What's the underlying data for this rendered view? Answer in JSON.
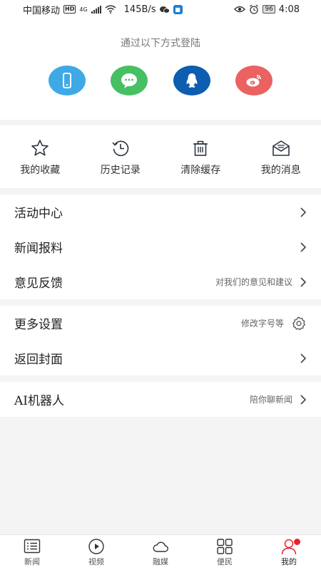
{
  "status_bar": {
    "carrier": "中国移动",
    "hd": "HD",
    "network": "4G",
    "speed": "145B/s",
    "battery": "96",
    "time": "4:08"
  },
  "login": {
    "title": "通过以下方式登陆",
    "methods": [
      {
        "icon": "phone-icon",
        "color": "#3fa9e6"
      },
      {
        "icon": "wechat-icon",
        "color": "#47bf63"
      },
      {
        "icon": "qq-icon",
        "color": "#0d5db0"
      },
      {
        "icon": "weibo-icon",
        "color": "#ea6261"
      }
    ]
  },
  "quick_actions": [
    {
      "icon": "star-icon",
      "label": "我的收藏"
    },
    {
      "icon": "history-icon",
      "label": "历史记录"
    },
    {
      "icon": "trash-icon",
      "label": "清除缓存"
    },
    {
      "icon": "mail-icon",
      "label": "我的消息"
    }
  ],
  "menu": {
    "group1": [
      {
        "label": "活动中心",
        "hint": ""
      },
      {
        "label": "新闻报料",
        "hint": ""
      },
      {
        "label": "意见反馈",
        "hint": "对我们的意见和建议"
      }
    ],
    "group2": [
      {
        "label": "更多设置",
        "hint": "修改字号等"
      },
      {
        "label": "返回封面",
        "hint": ""
      }
    ],
    "group3": [
      {
        "label": "AI机器人",
        "hint": "陪你聊新闻"
      }
    ]
  },
  "bottom_nav": [
    {
      "icon": "news-icon",
      "label": "新闻"
    },
    {
      "icon": "video-icon",
      "label": "视频"
    },
    {
      "icon": "cloud-icon",
      "label": "融媒"
    },
    {
      "icon": "grid-icon",
      "label": "便民"
    },
    {
      "icon": "user-icon",
      "label": "我的",
      "active": true
    }
  ],
  "colors": {
    "accent_red": "#e8232f",
    "background": "#f4f4f5"
  }
}
